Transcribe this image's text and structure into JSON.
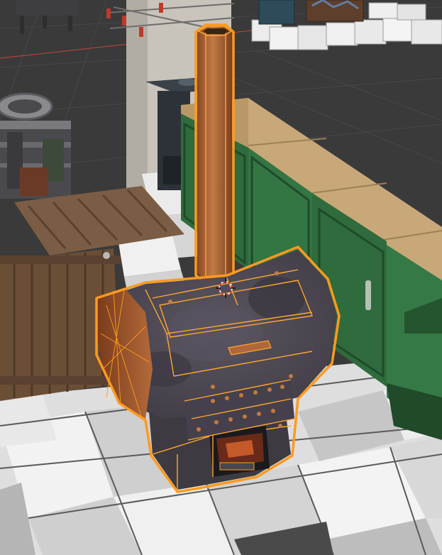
{
  "viewport": {
    "background": "#3a3a3a",
    "selection_color": "#ff9a1f",
    "grid_color": "#474747",
    "x_axis_color": "#b3413e",
    "floor_tile_light": "#e9e9e9",
    "floor_tile_dark": "#c8c8c8",
    "counter_top_color": "#c8a878",
    "cabinet_color": "#2f6b3c",
    "crate_color": "#6b4e36",
    "stove_body_color": "#4f4a55",
    "chimney_color": "#b0683a"
  },
  "scene": {
    "selected_object": "stove-with-chimney",
    "objects": [
      "floor-tiles",
      "counter-top",
      "green-cabinets",
      "wooden-crate",
      "metal-shelf",
      "iron-stand",
      "stove-with-chimney",
      "white-boxes",
      "tower-frame"
    ]
  },
  "cursor": {
    "icon": "3d-cursor-icon"
  }
}
